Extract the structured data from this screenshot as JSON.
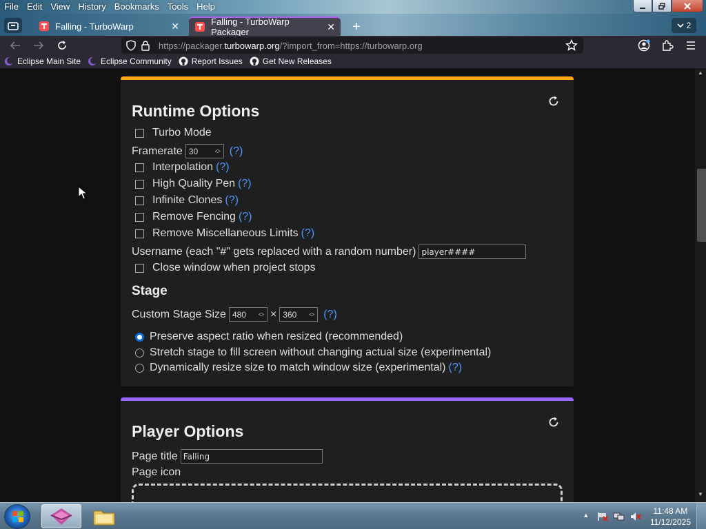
{
  "menu": [
    "File",
    "Edit",
    "View",
    "History",
    "Bookmarks",
    "Tools",
    "Help"
  ],
  "tabs": {
    "inactive_title": "Falling - TurboWarp",
    "active_title": "Falling - TurboWarp Packager",
    "count": "2"
  },
  "url": {
    "prefix": "https://packager.",
    "domain": "turbowarp.org",
    "suffix": "/?import_from=https://turbowarp.org"
  },
  "bookmarks": [
    "Eclipse Main Site",
    "Eclipse Community",
    "Report Issues",
    "Get New Releases"
  ],
  "runtime": {
    "heading": "Runtime Options",
    "turbo": "Turbo Mode",
    "framerate_label": "Framerate",
    "framerate_value": "30",
    "interpolation": "Interpolation",
    "hq_pen": "High Quality Pen",
    "infinite_clones": "Infinite Clones",
    "remove_fencing": "Remove Fencing",
    "remove_misc": "Remove Miscellaneous Limits",
    "username_label": "Username (each \"#\" gets replaced with a random number)",
    "username_value": "player####",
    "close_window": "Close window when project stops",
    "help": "(?)"
  },
  "stage": {
    "heading": "Stage",
    "size_label": "Custom Stage Size",
    "width": "480",
    "times": "×",
    "height": "360",
    "opt_preserve": "Preserve aspect ratio when resized (recommended)",
    "opt_stretch": "Stretch stage to fill screen without changing actual size (experimental)",
    "opt_dynamic": "Dynamically resize size to match window size (experimental)"
  },
  "player": {
    "heading": "Player Options",
    "title_label": "Page title",
    "title_value": "Falling",
    "icon_label": "Page icon"
  },
  "clock": {
    "time": "11:48 AM",
    "date": "11/12/2025"
  },
  "colors": {
    "runtime_accent": "#ffa619",
    "player_accent": "#9966ff",
    "help_link": "#4c97ff"
  }
}
